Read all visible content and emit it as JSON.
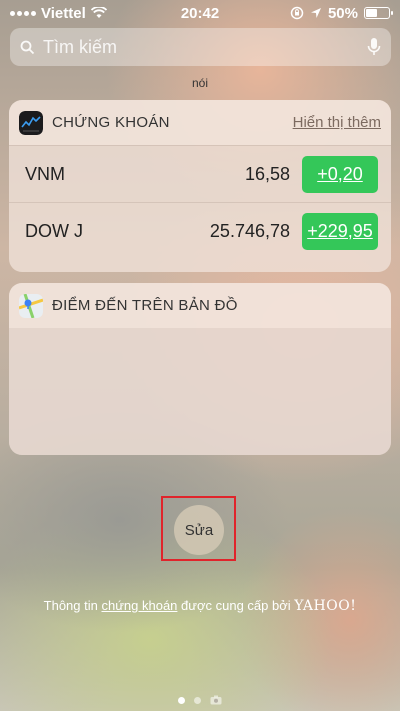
{
  "status_bar": {
    "carrier": "Viettel",
    "time": "20:42",
    "battery": "50%",
    "battery_level": 0.5
  },
  "search": {
    "placeholder": "Tìm kiếm"
  },
  "partial_widget_label": "nói",
  "stocks_widget": {
    "title": "CHỨNG KHOÁN",
    "action": "Hiển thị thêm",
    "rows": [
      {
        "symbol": "VNM",
        "price": "16,58",
        "change": "+0,20"
      },
      {
        "symbol": "DOW J",
        "price": "25.746,78",
        "change": "+229,95"
      }
    ],
    "change_color": "#34c759"
  },
  "maps_widget": {
    "title": "ĐIỂM ĐẾN TRÊN BẢN ĐỒ"
  },
  "edit_button": {
    "label": "Sửa"
  },
  "attribution": {
    "prefix": "Thông tin",
    "link": "chứng khoán",
    "suffix": "được cung cấp bởi",
    "provider": "YAHOO!"
  },
  "page_indicator": {
    "pages": 2,
    "current": 1
  },
  "colors": {
    "highlight": "#e0242b"
  }
}
